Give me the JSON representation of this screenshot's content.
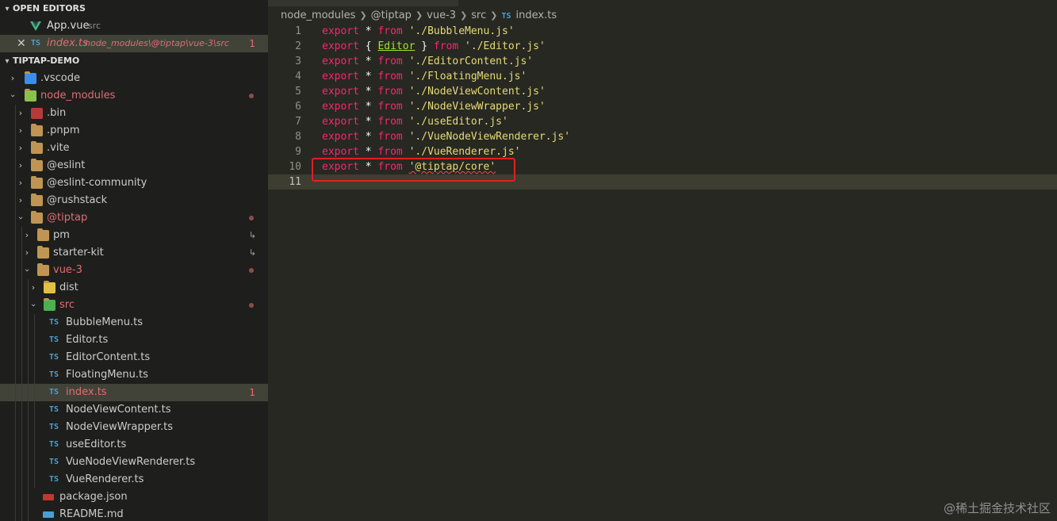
{
  "open_editors": {
    "header": "OPEN EDITORS",
    "items": [
      {
        "name": "App.vue",
        "path": "src"
      },
      {
        "name": "index.ts",
        "path": "node_modules\\@tiptap\\vue-3\\src",
        "badge": "1"
      }
    ]
  },
  "explorer": {
    "header": "TIPTAP-DEMO",
    "items": {
      "vscode": ".vscode",
      "node_modules": "node_modules",
      "bin": ".bin",
      "pnpm": ".pnpm",
      "vite": ".vite",
      "eslint": "@eslint",
      "eslint_community": "@eslint-community",
      "rushstack": "@rushstack",
      "tiptap": "@tiptap",
      "pm": "pm",
      "starter_kit": "starter-kit",
      "vue3": "vue-3",
      "dist": "dist",
      "src": "src",
      "f1": "BubbleMenu.ts",
      "f2": "Editor.ts",
      "f3": "EditorContent.ts",
      "f4": "FloatingMenu.ts",
      "f5": "index.ts",
      "f5_badge": "1",
      "f6": "NodeViewContent.ts",
      "f7": "NodeViewWrapper.ts",
      "f8": "useEditor.ts",
      "f9": "VueNodeViewRenderer.ts",
      "f10": "VueRenderer.ts",
      "pkg": "package.json",
      "readme": "README.md"
    },
    "link_symbol": "↳",
    "ts_label": "TS"
  },
  "breadcrumb": [
    "node_modules",
    "@tiptap",
    "vue-3",
    "src",
    "index.ts"
  ],
  "code": {
    "lines": [
      {
        "n": "1",
        "kw": "export",
        "mid": " * ",
        "from": "from",
        "str": " './BubbleMenu.js'"
      },
      {
        "n": "2",
        "kw": "export",
        "mid_a": " { ",
        "ident": "Editor",
        "mid_b": " } ",
        "from": "from",
        "str": " './Editor.js'"
      },
      {
        "n": "3",
        "kw": "export",
        "mid": " * ",
        "from": "from",
        "str": " './EditorContent.js'"
      },
      {
        "n": "4",
        "kw": "export",
        "mid": " * ",
        "from": "from",
        "str": " './FloatingMenu.js'"
      },
      {
        "n": "5",
        "kw": "export",
        "mid": " * ",
        "from": "from",
        "str": " './NodeViewContent.js'"
      },
      {
        "n": "6",
        "kw": "export",
        "mid": " * ",
        "from": "from",
        "str": " './NodeViewWrapper.js'"
      },
      {
        "n": "7",
        "kw": "export",
        "mid": " * ",
        "from": "from",
        "str": " './useEditor.js'"
      },
      {
        "n": "8",
        "kw": "export",
        "mid": " * ",
        "from": "from",
        "str": " './VueNodeViewRenderer.js'"
      },
      {
        "n": "9",
        "kw": "export",
        "mid": " * ",
        "from": "from",
        "str": " './VueRenderer.js'"
      },
      {
        "n": "10",
        "kw": "export",
        "mid": " * ",
        "from": "from",
        "str": "'@tiptap/core'"
      },
      {
        "n": "11"
      }
    ]
  },
  "watermark": "@稀土掘金技术社区",
  "colors": {
    "keyword": "#f92672",
    "string": "#e6db74",
    "identifier": "#a6e22e",
    "error": "#f14c4c",
    "highlight_box": "#e02020"
  }
}
